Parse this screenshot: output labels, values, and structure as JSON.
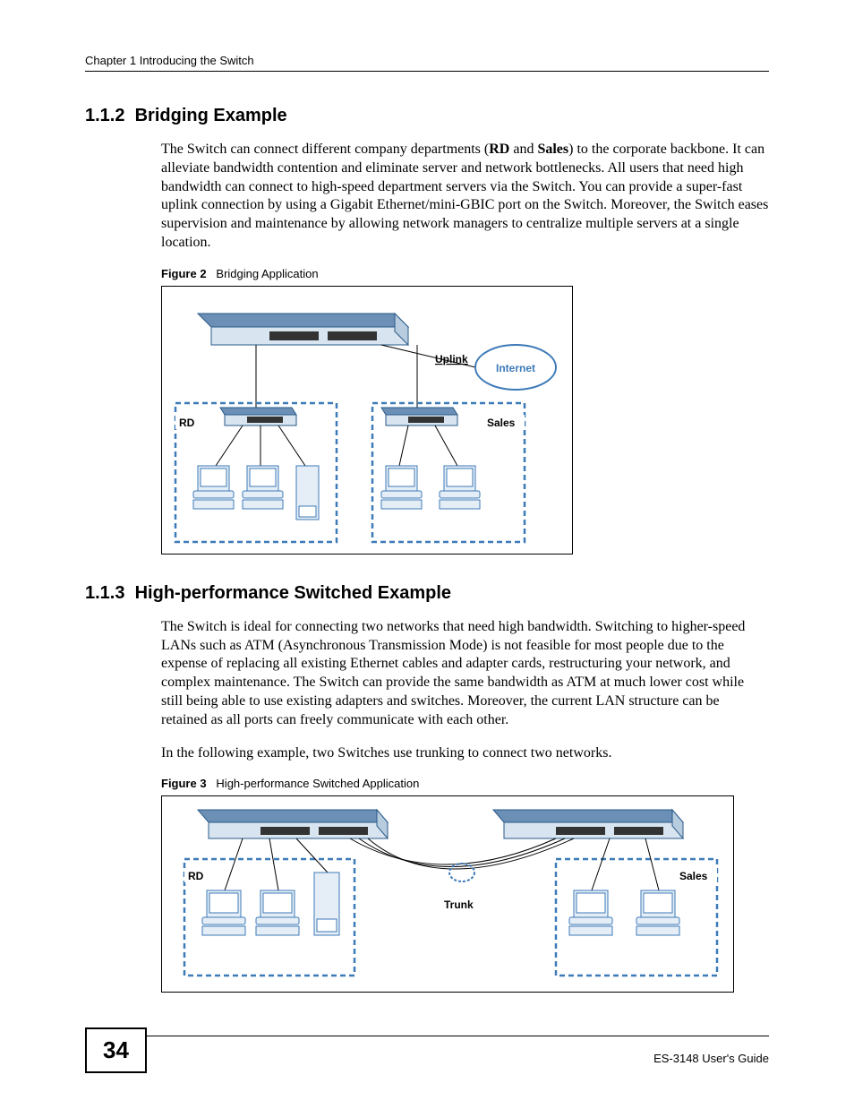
{
  "header": {
    "text": "Chapter 1 Introducing the Switch"
  },
  "sections": {
    "s112": {
      "number": "1.1.2",
      "title": "Bridging Example",
      "paragraph": "The Switch can connect different company departments (RD and Sales) to the corporate backbone. It can alleviate bandwidth contention and eliminate server and network bottlenecks. All users that need high bandwidth can connect to high-speed department servers via the Switch. You can provide a super-fast uplink connection by using a Gigabit Ethernet/mini-GBIC port on the Switch. Moreover, the Switch eases supervision and maintenance by allowing network managers to centralize multiple servers at a single location."
    },
    "s113": {
      "number": "1.1.3",
      "title": "High-performance Switched Example",
      "paragraph1": "The Switch is ideal for connecting two networks that need high bandwidth. Switching to higher-speed LANs such as ATM (Asynchronous Transmission Mode) is not feasible for most people due to the expense of replacing all existing Ethernet cables and adapter cards, restructuring your network, and complex maintenance. The Switch can provide the same bandwidth as ATM at much lower cost while still being able to use existing adapters and switches. Moreover, the current LAN structure can be retained as all ports can freely communicate with each other.",
      "paragraph2": "In the following example, two Switches use trunking to connect two networks."
    }
  },
  "figures": {
    "fig2": {
      "label": "Figure 2",
      "caption": "Bridging Application",
      "labels": {
        "uplink": "Uplink",
        "internet": "Internet",
        "rd": "RD",
        "sales": "Sales"
      }
    },
    "fig3": {
      "label": "Figure 3",
      "caption": "High-performance Switched Application",
      "labels": {
        "rd": "RD",
        "sales": "Sales",
        "trunk": "Trunk"
      }
    }
  },
  "footer": {
    "page": "34",
    "guide": "ES-3148 User's Guide"
  }
}
